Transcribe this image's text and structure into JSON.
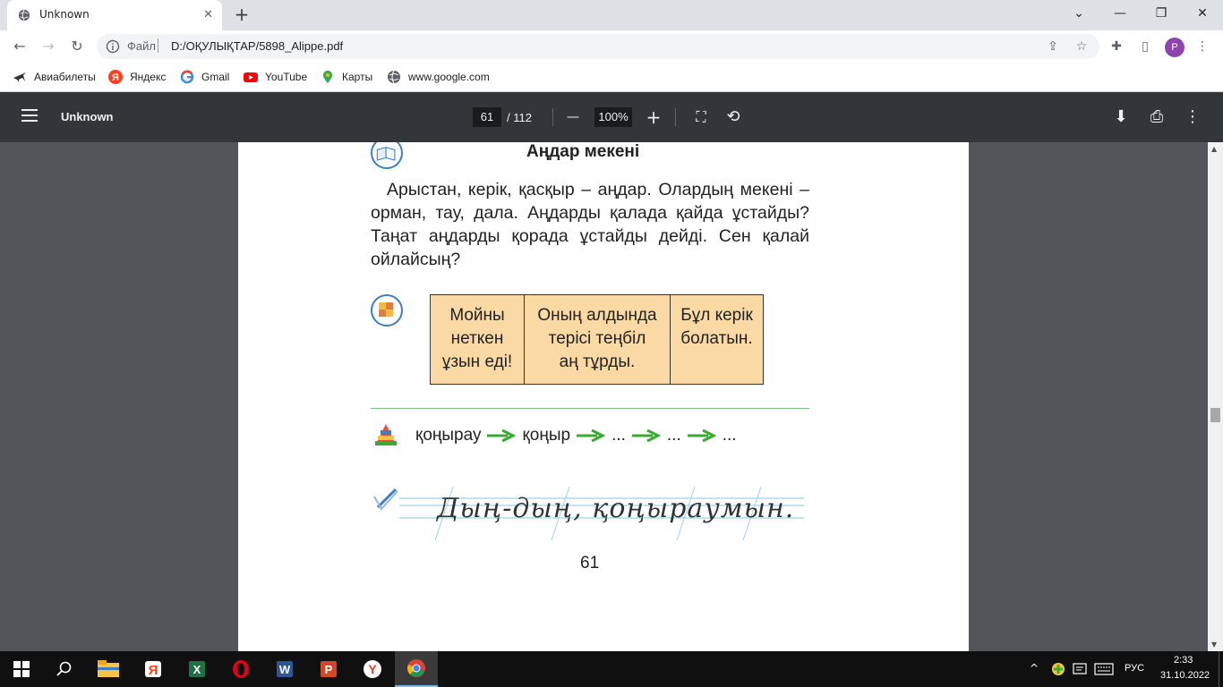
{
  "browser": {
    "tab_title": "Unknown",
    "tab_close": "✕",
    "new_tab": "+",
    "window_controls": [
      "⌄",
      "—",
      "❐",
      "✕"
    ],
    "nav": {
      "back": "←",
      "forward": "→",
      "reload": "↻"
    },
    "omnibox": {
      "scheme": "Файл",
      "url": "D:/ОҚУЛЫҚТАР/5898_Alippe.pdf"
    },
    "profile_initial": "P",
    "toolbar_icons": {
      "share": "⇪",
      "bookmark": "☆",
      "extensions": "✚",
      "side_panel": "▯",
      "menu": "⋮"
    }
  },
  "bookmarks": [
    {
      "label": "Авиабилеты",
      "icon": "plane-icon"
    },
    {
      "label": "Яндекс",
      "icon": "yandex-icon"
    },
    {
      "label": "Gmail",
      "icon": "google-icon"
    },
    {
      "label": "YouTube",
      "icon": "youtube-icon"
    },
    {
      "label": "Карты",
      "icon": "maps-pin-icon"
    },
    {
      "label": "www.google.com",
      "icon": "globe-icon"
    }
  ],
  "pdf_toolbar": {
    "title": "Unknown",
    "current_page": "61",
    "total_pages": "/ 112",
    "zoom": "100%",
    "zoom_out": "—",
    "zoom_in": "+",
    "fit_icon": "⛶",
    "rotate_icon": "⟲",
    "download_icon": "⬇",
    "print_icon": "⎙",
    "more_icon": "⋮"
  },
  "pdf_page": {
    "heading": "Аңдар мекені",
    "paragraph": "Арыстан, керік, қасқыр – аңдар. Олардың мекені – орман, тау, дала. Аңдарды қалада қайда ұстайды? Таңат аңдарды қорада ұстайды дейді. Сен қалай ойлайсың?",
    "table_cells": [
      [
        "Мойны",
        "неткен",
        "ұзын еді!"
      ],
      [
        "Оның алдында",
        "терісі теңбіл",
        "аң тұрды."
      ],
      [
        "Бұл керік",
        "болатын."
      ]
    ],
    "word_chain": [
      "қоңырау",
      "қоңыр",
      "...",
      "...",
      "..."
    ],
    "handwriting": "Дың-дың, қоңыраумын.",
    "page_number": "61"
  },
  "taskbar": {
    "apps": [
      "windows-start",
      "search",
      "file-explorer",
      "yandex-browser",
      "excel",
      "opera",
      "word",
      "powerpoint",
      "yandex",
      "chrome"
    ],
    "language": "РУС",
    "time": "2:33",
    "date": "31.10.2022"
  },
  "colors": {
    "accent_arrow": "#3aaa35",
    "table_fill": "#fbd9a4",
    "icon_ring": "#3c7fc4"
  }
}
